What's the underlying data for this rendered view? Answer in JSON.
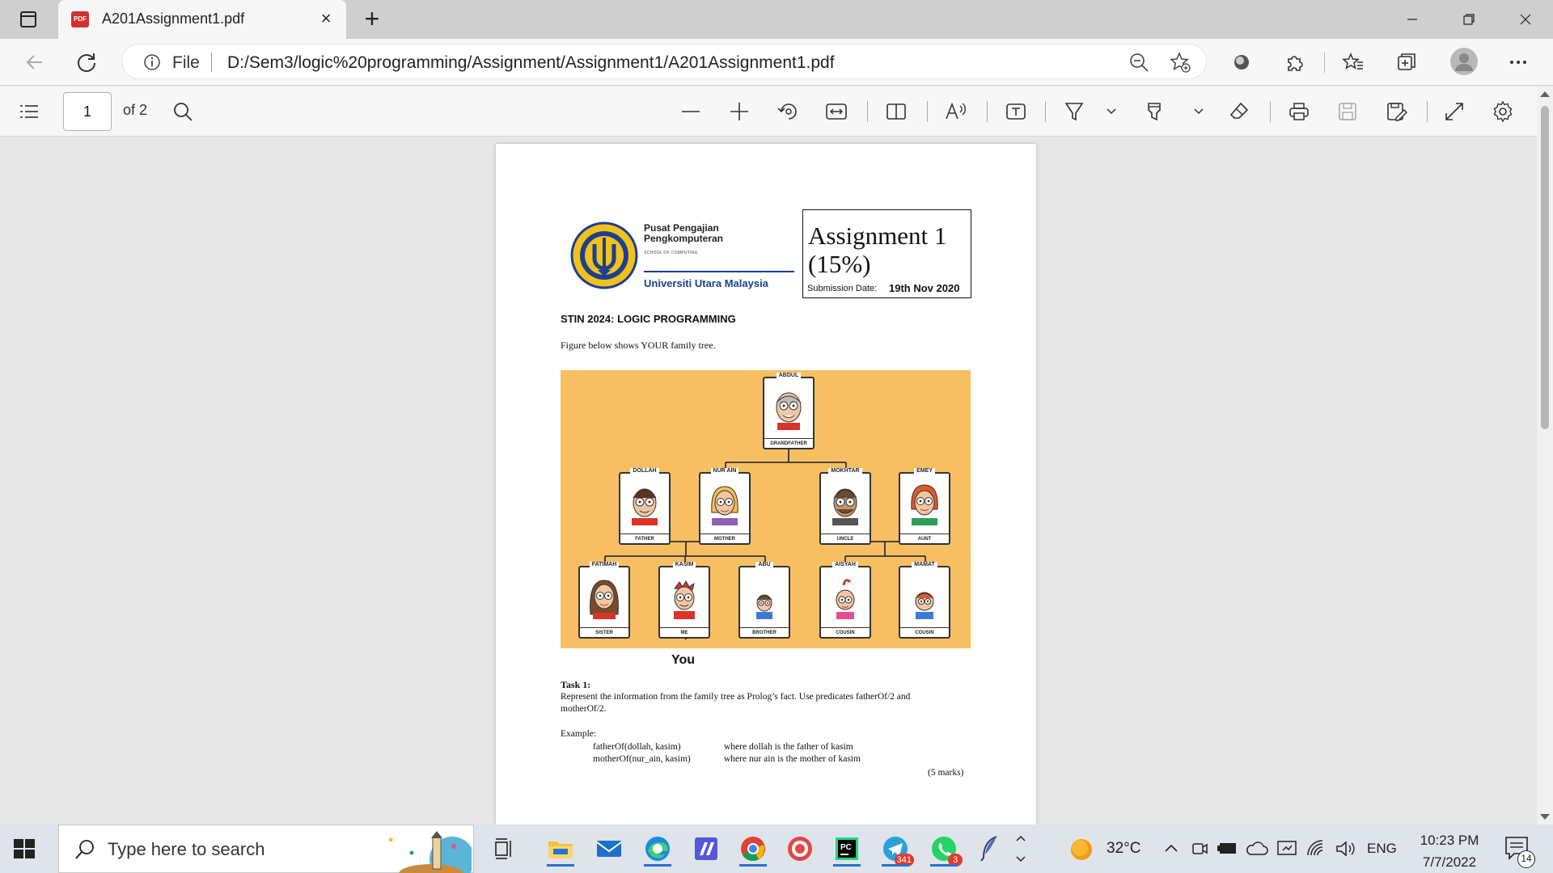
{
  "browser": {
    "tab_title": "A201Assignment1.pdf",
    "favicon_text": "PDF",
    "address_scheme": "File",
    "address_url": "D:/Sem3/logic%20programming/Assignment/Assignment1/A201Assignment1.pdf"
  },
  "pdf_toolbar": {
    "page_number": "1",
    "page_total": "of 2"
  },
  "document": {
    "school_line1": "Pusat Pengajian",
    "school_line2": "Pengkomputeran",
    "school_sub": "SCHOOL OF COMPUTING",
    "university": "Universiti Utara Malaysia",
    "assignment_title": "Assignment 1",
    "assignment_weight": "(15%)",
    "submission_label": "Submission Date:",
    "submission_date": "19th Nov 2020",
    "course": "STIN 2024: LOGIC PROGRAMMING",
    "figure_caption": "Figure below shows YOUR family tree.",
    "you_label": "You",
    "task_heading": "Task 1:",
    "task_text_1": "Represent the information from the family tree as Prolog’s fact.  Use predicates fatherOf/2 and",
    "task_text_2": "motherOf/2.",
    "example_label": "Example:",
    "example_1_code": "fatherOf(dollah, kasim)",
    "example_1_desc": "where dollah is the father of kasim",
    "example_2_code": "motherOf(nur_ain, kasim)",
    "example_2_desc": "where nur ain is the mother of kasim",
    "marks": "(5 marks)"
  },
  "family_tree": {
    "grandfather": {
      "name": "ABDUL",
      "role": "GRANDFATHER"
    },
    "father": {
      "name": "DOLLAH",
      "role": "FATHER"
    },
    "mother": {
      "name": "NUR AIN",
      "role": "MOTHER"
    },
    "uncle": {
      "name": "MOKHTAR",
      "role": "UNCLE"
    },
    "aunt": {
      "name": "EMEY",
      "role": "AUNT"
    },
    "sister": {
      "name": "FATIMAH",
      "role": "SISTER"
    },
    "me": {
      "name": "KASIM",
      "role": "ME"
    },
    "brother": {
      "name": "ABU",
      "role": "BROTHER"
    },
    "cousin1": {
      "name": "AISYAH",
      "role": "COUSIN"
    },
    "cousin2": {
      "name": "MAMAT",
      "role": "COUSIN"
    },
    "background_color": "#f8bf62"
  },
  "taskbar": {
    "search_placeholder": "Type here to search",
    "temperature": "32°C",
    "language": "ENG",
    "time": "10:23 PM",
    "date": "7/7/2022",
    "notification_count": "14",
    "telegram_badge": "341",
    "whatsapp_badge": "3"
  },
  "colors": {
    "accent": "#1c3f91",
    "taskbar_active": "#2a6fd6"
  }
}
